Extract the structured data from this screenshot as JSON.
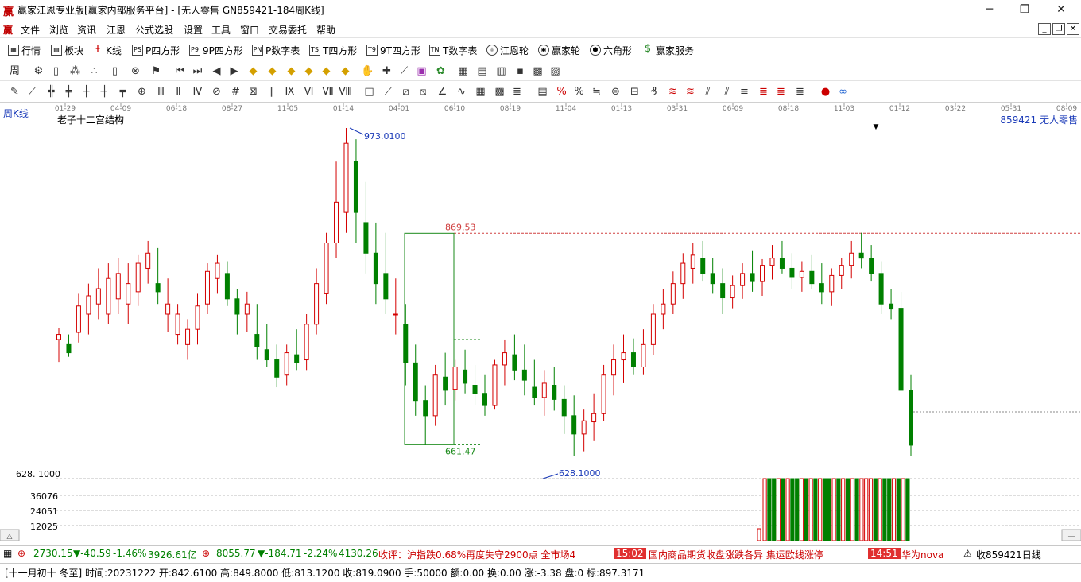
{
  "window": {
    "app_icon": "赢",
    "title": "赢家江恩专业版[赢家内部服务平台] - [无人零售  GN859421-184周K线]",
    "minimize": "─",
    "maximize": "❐",
    "close": "✕"
  },
  "menu": {
    "icon": "赢",
    "items": [
      "文件",
      "浏览",
      "资讯",
      "江恩",
      "公式选股",
      "设置",
      "工具",
      "窗口",
      "交易委托",
      "帮助"
    ],
    "mdi": [
      "_",
      "❐",
      "✕"
    ]
  },
  "toolbar1": [
    {
      "label": "行情",
      "icon": "grid-icon"
    },
    {
      "label": "板块",
      "icon": "sector-icon"
    },
    {
      "label": "K线",
      "icon": "kline-icon"
    },
    {
      "label": "P四方形",
      "icon": "PS"
    },
    {
      "label": "9P四方形",
      "icon": "P9"
    },
    {
      "label": "P数字表",
      "icon": "PN"
    },
    {
      "label": "T四方形",
      "icon": "TS"
    },
    {
      "label": "9T四方形",
      "icon": "T9"
    },
    {
      "label": "T数字表",
      "icon": "TN"
    },
    {
      "label": "江恩轮",
      "icon": "wheel-icon"
    },
    {
      "label": "赢家轮",
      "icon": "wheel2-icon"
    },
    {
      "label": "六角形",
      "icon": "hexagon-icon"
    },
    {
      "label": "赢家服务",
      "icon": "dollar-icon"
    }
  ],
  "chart": {
    "period_label": "周K线",
    "indicator_title": "老子十二宫结构",
    "symbol_label": "859421  无人零售",
    "date_ticks": [
      "01-29",
      "04-09",
      "06-18",
      "08-27",
      "11-05",
      "01-14",
      "04-01",
      "06-10",
      "08-19",
      "11-04",
      "01-13",
      "03-31",
      "06-09",
      "08-18",
      "11-03",
      "01-12",
      "03-22",
      "05-31",
      "08-09"
    ],
    "annotations": {
      "high": "973.0100",
      "box_top": "869.53",
      "box_bottom": "661.47",
      "low": "628.1000",
      "price_axis_low": "628. 1000"
    },
    "volume_ticks": [
      "36076",
      "24051",
      "12025"
    ]
  },
  "chart_data": {
    "type": "candlestick",
    "period": "weekly",
    "price_range": [
      628.1,
      973.01
    ],
    "key_levels": {
      "high": 973.01,
      "box_top": 869.53,
      "box_bottom": 661.47,
      "low": 628.1
    },
    "volume_ticks": [
      36076,
      24051,
      12025
    ],
    "candles_ohlc": [
      [
        765,
        776,
        743,
        770
      ],
      [
        760,
        770,
        748,
        752
      ],
      [
        772,
        810,
        762,
        798
      ],
      [
        790,
        820,
        770,
        808
      ],
      [
        800,
        835,
        785,
        815
      ],
      [
        790,
        840,
        780,
        825
      ],
      [
        805,
        845,
        790,
        830
      ],
      [
        800,
        840,
        780,
        820
      ],
      [
        812,
        848,
        798,
        840
      ],
      [
        835,
        862,
        820,
        850
      ],
      [
        820,
        855,
        800,
        812
      ],
      [
        790,
        825,
        772,
        800
      ],
      [
        770,
        800,
        760,
        790
      ],
      [
        760,
        785,
        745,
        775
      ],
      [
        775,
        810,
        760,
        798
      ],
      [
        800,
        840,
        790,
        832
      ],
      [
        825,
        848,
        810,
        840
      ],
      [
        830,
        842,
        798,
        805
      ],
      [
        805,
        815,
        770,
        790
      ],
      [
        790,
        812,
        772,
        800
      ],
      [
        770,
        800,
        745,
        758
      ],
      [
        755,
        780,
        738,
        745
      ],
      [
        745,
        760,
        718,
        728
      ],
      [
        730,
        760,
        720,
        752
      ],
      [
        750,
        775,
        735,
        742
      ],
      [
        745,
        790,
        735,
        780
      ],
      [
        780,
        835,
        770,
        820
      ],
      [
        810,
        870,
        800,
        860
      ],
      [
        860,
        940,
        845,
        900
      ],
      [
        890,
        973,
        870,
        958
      ],
      [
        940,
        962,
        860,
        890
      ],
      [
        880,
        920,
        830,
        850
      ],
      [
        850,
        880,
        800,
        820
      ],
      [
        830,
        870,
        790,
        805
      ],
      [
        790,
        825,
        770,
        790
      ],
      [
        780,
        800,
        720,
        742
      ],
      [
        742,
        760,
        690,
        705
      ],
      [
        705,
        720,
        661,
        690
      ],
      [
        690,
        740,
        680,
        730
      ],
      [
        728,
        752,
        700,
        715
      ],
      [
        716,
        745,
        705,
        738
      ],
      [
        735,
        755,
        712,
        722
      ],
      [
        720,
        740,
        700,
        712
      ],
      [
        712,
        730,
        690,
        700
      ],
      [
        700,
        745,
        696,
        740
      ],
      [
        740,
        765,
        720,
        752
      ],
      [
        750,
        770,
        725,
        735
      ],
      [
        735,
        760,
        710,
        725
      ],
      [
        718,
        745,
        700,
        708
      ],
      [
        708,
        735,
        690,
        722
      ],
      [
        720,
        738,
        695,
        706
      ],
      [
        706,
        720,
        672,
        690
      ],
      [
        690,
        710,
        650,
        672
      ],
      [
        672,
        696,
        655,
        685
      ],
      [
        684,
        712,
        665,
        692
      ],
      [
        692,
        740,
        685,
        730
      ],
      [
        730,
        760,
        710,
        745
      ],
      [
        745,
        770,
        722,
        752
      ],
      [
        752,
        766,
        730,
        738
      ],
      [
        738,
        775,
        730,
        760
      ],
      [
        760,
        800,
        750,
        790
      ],
      [
        790,
        815,
        775,
        800
      ],
      [
        800,
        832,
        790,
        820
      ],
      [
        820,
        850,
        805,
        840
      ],
      [
        835,
        860,
        820,
        848
      ],
      [
        845,
        862,
        822,
        830
      ],
      [
        830,
        845,
        810,
        820
      ],
      [
        820,
        835,
        790,
        806
      ],
      [
        806,
        828,
        795,
        818
      ],
      [
        818,
        840,
        805,
        830
      ],
      [
        830,
        852,
        812,
        822
      ],
      [
        822,
        844,
        808,
        838
      ],
      [
        838,
        858,
        824,
        845
      ],
      [
        845,
        862,
        830,
        835
      ],
      [
        835,
        850,
        815,
        826
      ],
      [
        826,
        842,
        812,
        832
      ],
      [
        832,
        848,
        815,
        820
      ],
      [
        820,
        840,
        800,
        812
      ],
      [
        812,
        835,
        798,
        828
      ],
      [
        828,
        845,
        815,
        838
      ],
      [
        838,
        862,
        825,
        850
      ],
      [
        850,
        870,
        835,
        845
      ],
      [
        845,
        858,
        822,
        830
      ],
      [
        830,
        842,
        790,
        800
      ],
      [
        800,
        815,
        785,
        795
      ],
      [
        795,
        812,
        760,
        715
      ],
      [
        715,
        730,
        650,
        661
      ]
    ]
  },
  "ticker": {
    "items": [
      {
        "text": "2730.15",
        "cls": "down"
      },
      {
        "text": "▼-40.59",
        "cls": "down"
      },
      {
        "text": "-1.46%",
        "cls": "down"
      },
      {
        "text": "3926.61亿",
        "cls": "down"
      },
      {
        "text": "8055.77",
        "cls": "down"
      },
      {
        "text": "▼-184.71",
        "cls": "down"
      },
      {
        "text": "-2.24%",
        "cls": "down"
      },
      {
        "text": "4130.26",
        "cls": "down"
      }
    ],
    "news1": "收评：沪指跌0.68%再度失守2900点 全市场4",
    "time1": "15:02",
    "news2": "国内商品期货收盘涨跌各异 集运欧线涨停",
    "time2": "14:51",
    "news3": "华为nova",
    "right": "收859421日线"
  },
  "status": {
    "text": "[十一月初十 冬至] 时间:20231222 开:842.6100 高:849.8000 低:813.1200 收:819.0900 手:50000 额:0.00 换:0.00 涨:-3.38 盘:0 标:897.3171"
  }
}
